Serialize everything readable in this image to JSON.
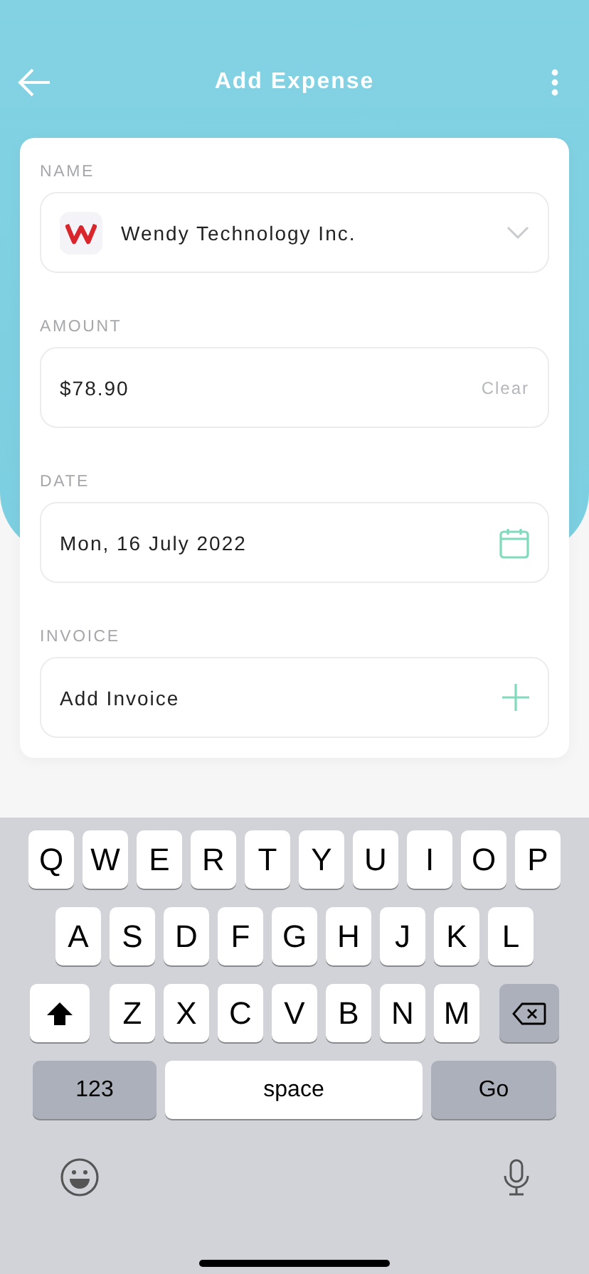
{
  "header": {
    "title": "Add Expense"
  },
  "fields": [
    {
      "kind": "select",
      "label": "NAME",
      "value": "Wendy Technology Inc."
    },
    {
      "kind": "amount",
      "label": "AMOUNT",
      "value": "$78.90",
      "action": "Clear"
    },
    {
      "kind": "date",
      "label": "DATE",
      "value": "Mon, 16 July 2022"
    },
    {
      "kind": "add",
      "label": "INVOICE",
      "value": "Add Invoice"
    }
  ],
  "keyboard": {
    "rows": [
      [
        "Q",
        "W",
        "E",
        "R",
        "T",
        "Y",
        "U",
        "I",
        "O",
        "P"
      ],
      [
        "A",
        "S",
        "D",
        "F",
        "G",
        "H",
        "J",
        "K",
        "L"
      ],
      [
        "Z",
        "X",
        "C",
        "V",
        "B",
        "N",
        "M"
      ]
    ],
    "numbers_key": "123",
    "space_key": "space",
    "go_key": "Go"
  }
}
